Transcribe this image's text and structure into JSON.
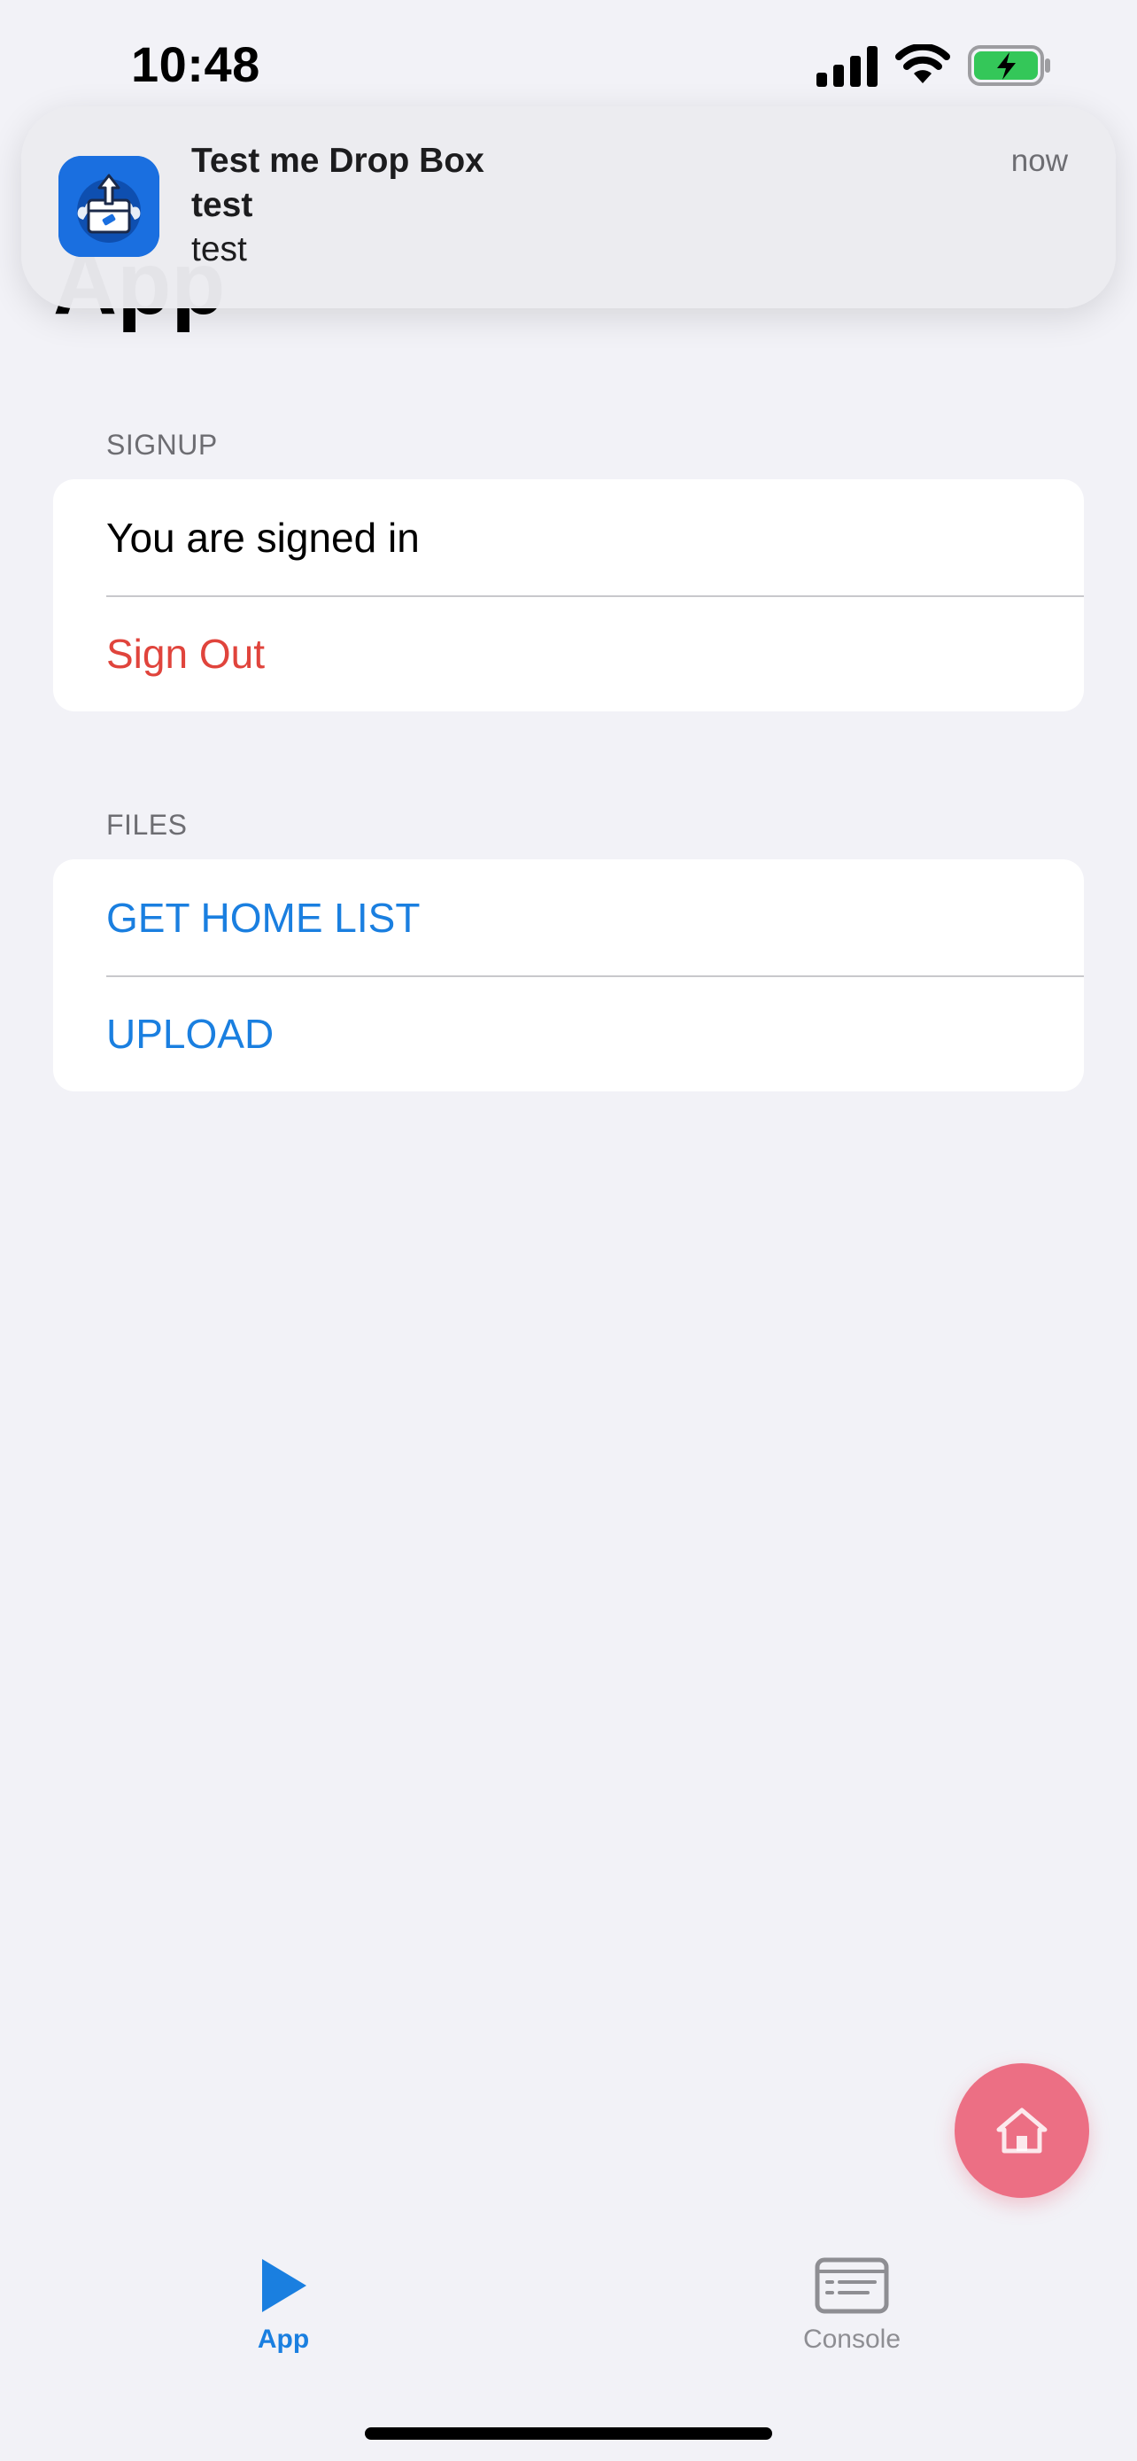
{
  "status_bar": {
    "time": "10:48"
  },
  "page": {
    "title": "App"
  },
  "notification": {
    "app_name": "Test me Drop Box",
    "title": "test",
    "body": "test",
    "time": "now",
    "icon": "app-upload-box-icon"
  },
  "sections": {
    "signup": {
      "header": "SIGNUP",
      "status_text": "You are signed in",
      "sign_out_label": "Sign Out"
    },
    "files": {
      "header": "FILES",
      "get_home_list_label": "GET HOME LIST",
      "upload_label": "UPLOAD"
    }
  },
  "fab": {
    "icon": "home-icon"
  },
  "tabs": [
    {
      "label": "App",
      "icon": "play-icon"
    },
    {
      "label": "Console",
      "icon": "console-icon"
    }
  ],
  "colors": {
    "accent": "#1a7fe0",
    "destructive": "#e0443c",
    "fab": "#ec6f84",
    "background": "#f2f2f7",
    "battery_charging": "#34c759"
  }
}
